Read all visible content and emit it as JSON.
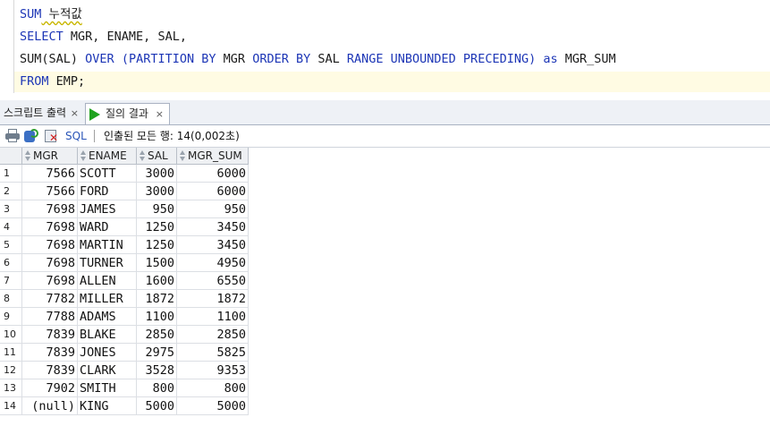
{
  "editor": {
    "lines": [
      {
        "kind": "comment",
        "kw": "SUM",
        "rest": " 누적값"
      },
      {
        "kind": "select",
        "kw": "SELECT",
        "rest": " MGR, ENAME, SAL,"
      },
      {
        "kind": "window",
        "fn": "SUM(SAL)",
        "over": "OVER",
        "open": "(",
        "partition": "PARTITION BY",
        "mgr": "MGR",
        "order": "ORDER BY",
        "sal": "SAL",
        "range": "RANGE UNBOUNDED PRECEDING",
        "close": ")",
        "as": "as",
        "alias": "MGR_SUM"
      },
      {
        "kind": "from",
        "kw": "FROM",
        "rest": " EMP;"
      }
    ]
  },
  "tabs": {
    "script_output": {
      "label": "스크립트 출력",
      "close": "×"
    },
    "query_result": {
      "label": "질의 결과",
      "close": "×"
    }
  },
  "toolbar": {
    "sql_label": "SQL",
    "status": "인출된 모든 행: 14(0,002초)"
  },
  "grid": {
    "columns": [
      "MGR",
      "ENAME",
      "SAL",
      "MGR_SUM"
    ],
    "rows": [
      [
        "1",
        "7566",
        "SCOTT",
        "3000",
        "6000"
      ],
      [
        "2",
        "7566",
        "FORD",
        "3000",
        "6000"
      ],
      [
        "3",
        "7698",
        "JAMES",
        "950",
        "950"
      ],
      [
        "4",
        "7698",
        "WARD",
        "1250",
        "3450"
      ],
      [
        "5",
        "7698",
        "MARTIN",
        "1250",
        "3450"
      ],
      [
        "6",
        "7698",
        "TURNER",
        "1500",
        "4950"
      ],
      [
        "7",
        "7698",
        "ALLEN",
        "1600",
        "6550"
      ],
      [
        "8",
        "7782",
        "MILLER",
        "1872",
        "1872"
      ],
      [
        "9",
        "7788",
        "ADAMS",
        "1100",
        "1100"
      ],
      [
        "10",
        "7839",
        "BLAKE",
        "2850",
        "2850"
      ],
      [
        "11",
        "7839",
        "JONES",
        "2975",
        "5825"
      ],
      [
        "12",
        "7839",
        "CLARK",
        "3528",
        "9353"
      ],
      [
        "13",
        "7902",
        "SMITH",
        "800",
        "800"
      ],
      [
        "14",
        "(null)",
        "KING",
        "5000",
        "5000"
      ]
    ]
  },
  "colors": {
    "keyword": "#1d36b6",
    "current_line": "#fffbe3",
    "run_icon": "#1fa21f"
  }
}
